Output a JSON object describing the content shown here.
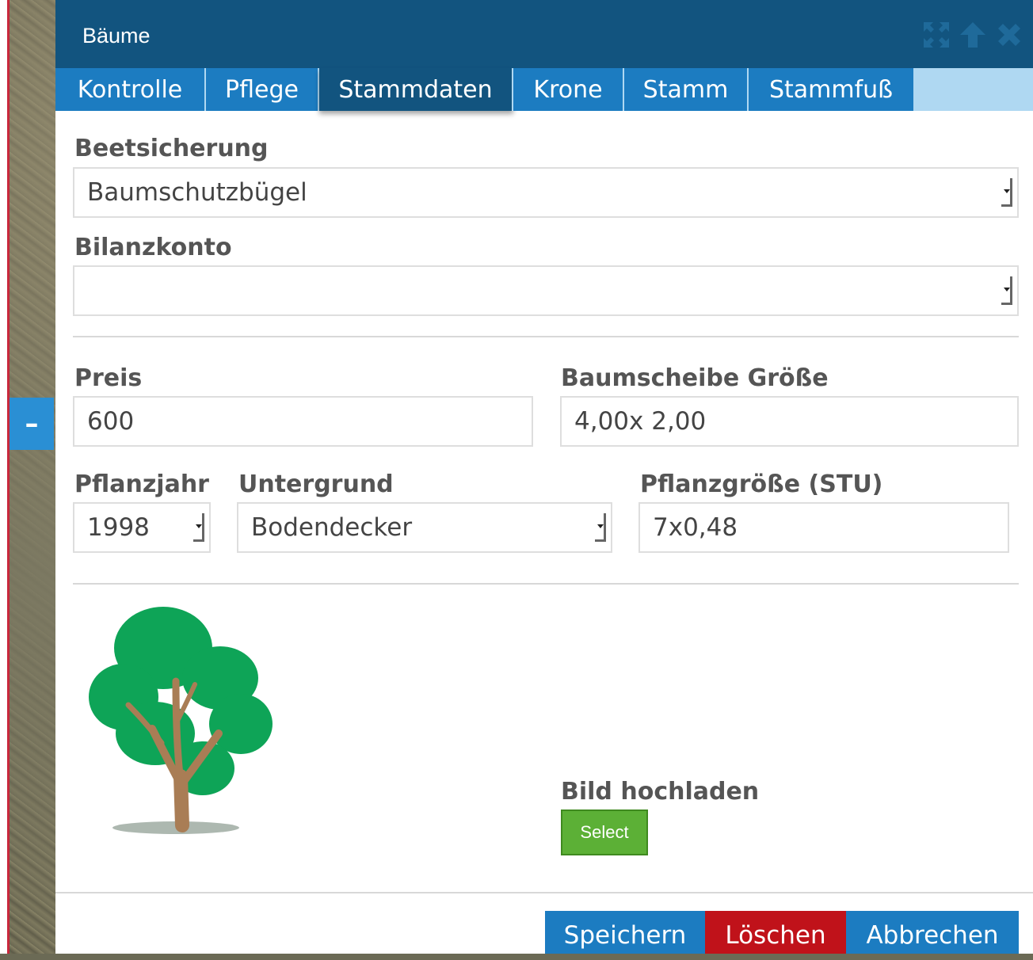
{
  "dialog": {
    "title": "Bäume"
  },
  "tabs": [
    {
      "label": "Kontrolle"
    },
    {
      "label": "Pflege"
    },
    {
      "label": "Stammdaten",
      "active": true
    },
    {
      "label": "Krone"
    },
    {
      "label": "Stamm"
    },
    {
      "label": "Stammfuß"
    }
  ],
  "form": {
    "beetsicherung": {
      "label": "Beetsicherung",
      "value": "Baumschutzbügel"
    },
    "bilanzkonto": {
      "label": "Bilanzkonto",
      "value": ""
    },
    "preis": {
      "label": "Preis",
      "value": "600"
    },
    "baumscheibe": {
      "label": "Baumscheibe Größe",
      "value": "4,00x 2,00"
    },
    "pflanzjahr": {
      "label": "Pflanzjahr",
      "value": "1998"
    },
    "untergrund": {
      "label": "Untergrund",
      "value": "Bodendecker"
    },
    "pflanzgroesse": {
      "label": "Pflanzgröße (STU)",
      "value": "7x0,48"
    }
  },
  "upload": {
    "label": "Bild hochladen",
    "select_label": "Select"
  },
  "footer": {
    "save_label": "Speichern",
    "delete_label": "Löschen",
    "cancel_label": "Abbrechen"
  },
  "sidebar": {
    "collapse_label": "–"
  },
  "colors": {
    "titlebar": "#12547f",
    "tab": "#1c7cc1",
    "save": "#1c7cc1",
    "delete": "#c0121a",
    "select": "#5cb036"
  },
  "icons": {
    "expand": "expand-icon",
    "up": "arrow-up-icon",
    "close": "close-icon",
    "tree": "tree-image"
  }
}
